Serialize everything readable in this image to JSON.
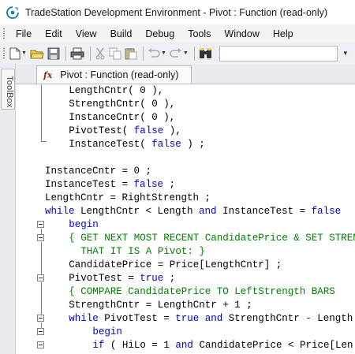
{
  "window": {
    "title": "TradeStation Development Environment - Pivot : Function (read-only)"
  },
  "menu": [
    "File",
    "Edit",
    "View",
    "Build",
    "Debug",
    "Tools",
    "Window",
    "Help"
  ],
  "toolbar": {
    "buttons": [
      "new-document-icon",
      "open-folder-icon",
      "save-icon",
      "print-icon",
      "cut-icon",
      "copy-icon",
      "paste-icon",
      "undo-icon",
      "redo-icon",
      "binoculars-icon"
    ]
  },
  "toolbox": {
    "label": "ToolBox"
  },
  "tab": {
    "label": "Pivot : Function (read-only)"
  },
  "code": [
    {
      "indent": 4,
      "parts": [
        {
          "t": "LengthCntr( 0 ),"
        }
      ]
    },
    {
      "indent": 4,
      "parts": [
        {
          "t": "StrengthCntr( 0 ),"
        }
      ]
    },
    {
      "indent": 4,
      "parts": [
        {
          "t": "InstanceCntr( 0 ),"
        }
      ]
    },
    {
      "indent": 4,
      "parts": [
        {
          "t": "PivotTest( "
        },
        {
          "t": "false",
          "k": "kw"
        },
        {
          "t": " ),"
        }
      ]
    },
    {
      "indent": 4,
      "parts": [
        {
          "t": "InstanceTest( "
        },
        {
          "t": "false",
          "k": "kw"
        },
        {
          "t": " ) ;"
        }
      ]
    },
    {
      "indent": 0,
      "parts": []
    },
    {
      "indent": 0,
      "parts": [
        {
          "t": "InstanceCntr = 0 ;"
        }
      ]
    },
    {
      "indent": 0,
      "parts": [
        {
          "t": "InstanceTest = "
        },
        {
          "t": "false",
          "k": "kw"
        },
        {
          "t": " ;"
        }
      ]
    },
    {
      "indent": 0,
      "parts": [
        {
          "t": "LengthCntr = RightStrength ;"
        }
      ]
    },
    {
      "indent": 0,
      "parts": [
        {
          "t": "while",
          "k": "kw"
        },
        {
          "t": " LengthCntr < Length "
        },
        {
          "t": "and",
          "k": "kw"
        },
        {
          "t": " InstanceTest = "
        },
        {
          "t": "false",
          "k": "kw"
        }
      ]
    },
    {
      "indent": 4,
      "parts": [
        {
          "t": "begin",
          "k": "kw"
        }
      ]
    },
    {
      "indent": 4,
      "parts": [
        {
          "t": "{ GET NEXT MOST RECENT CandidatePrice & SET STRENGTH",
          "k": "cm"
        }
      ]
    },
    {
      "indent": 6,
      "parts": [
        {
          "t": "THAT IT IS A Pivot: }",
          "k": "cm"
        }
      ]
    },
    {
      "indent": 4,
      "parts": [
        {
          "t": "CandidatePrice = Price[LengthCntr] ;"
        }
      ]
    },
    {
      "indent": 4,
      "parts": [
        {
          "t": "PivotTest = "
        },
        {
          "t": "true",
          "k": "kw"
        },
        {
          "t": " ;"
        }
      ]
    },
    {
      "indent": 4,
      "parts": [
        {
          "t": "{ COMPARE CandidatePrice TO LeftStrength BARS",
          "k": "cm"
        }
      ]
    },
    {
      "indent": 4,
      "parts": [
        {
          "t": "StrengthCntr = LengthCntr + 1 ;"
        }
      ]
    },
    {
      "indent": 4,
      "parts": [
        {
          "t": "while",
          "k": "kw"
        },
        {
          "t": " PivotTest = "
        },
        {
          "t": "true",
          "k": "kw"
        },
        {
          "t": " "
        },
        {
          "t": "and",
          "k": "kw"
        },
        {
          "t": " StrengthCntr - Length"
        }
      ]
    },
    {
      "indent": 8,
      "parts": [
        {
          "t": "begin",
          "k": "kw"
        }
      ]
    },
    {
      "indent": 8,
      "parts": [
        {
          "t": "if",
          "k": "kw"
        },
        {
          "t": " ( HiLo = 1 "
        },
        {
          "t": "and",
          "k": "kw"
        },
        {
          "t": " CandidatePrice < Price[Len"
        }
      ]
    }
  ]
}
